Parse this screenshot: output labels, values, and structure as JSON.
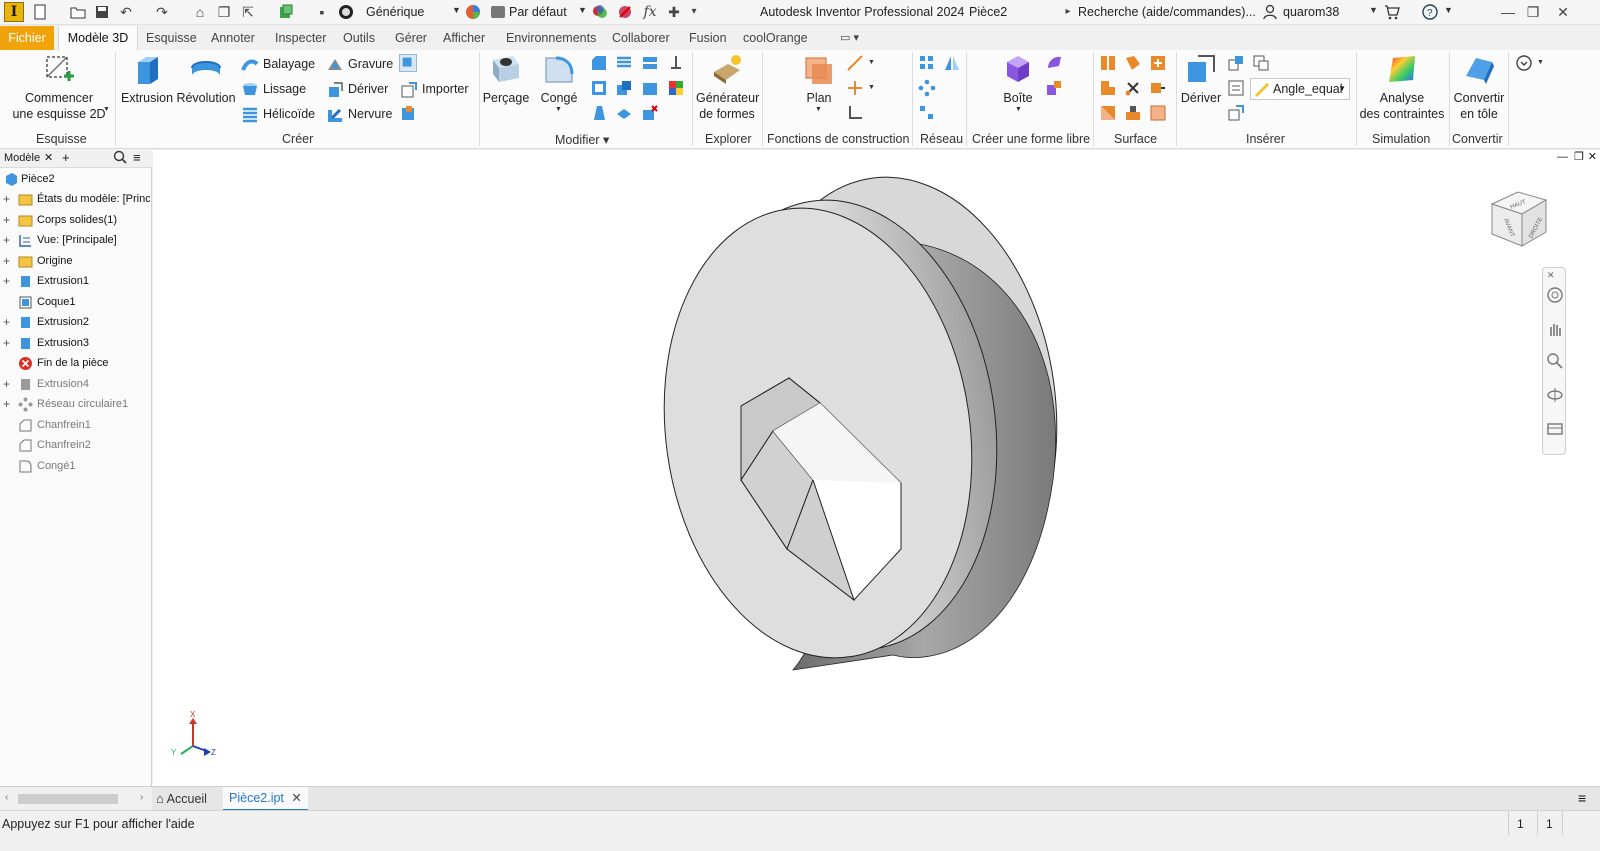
{
  "titlebar": {
    "style_value": "Générique",
    "appearance_value": "Par défaut",
    "app_title": "Autodesk Inventor Professional 2024",
    "doc_name": "Pièce2",
    "search_placeholder": "Recherche (aide/commandes)...",
    "username": "quarom38"
  },
  "tabs": {
    "file": "Fichier",
    "items": [
      "Modèle 3D",
      "Esquisse",
      "Annoter",
      "Inspecter",
      "Outils",
      "Gérer",
      "Afficher",
      "Environnements",
      "Collaborer",
      "Fusion",
      "coolOrange"
    ]
  },
  "ribbon": {
    "sketch": {
      "title": "Esquisse",
      "start_line1": "Commencer",
      "start_line2": "une esquisse 2D"
    },
    "create": {
      "title": "Créer",
      "extrusion": "Extrusion",
      "revolution": "Révolution",
      "balayage": "Balayage",
      "lissage": "Lissage",
      "helicoide": "Hélicoïde",
      "gravure": "Gravure",
      "deriver": "Dériver",
      "nervure": "Nervure",
      "importer": "Importer"
    },
    "modify": {
      "title": "Modifier",
      "percage": "Perçage",
      "conge": "Congé"
    },
    "explore": {
      "title": "Explorer",
      "gen_line1": "Générateur",
      "gen_line2": "de formes"
    },
    "work": {
      "title": "Fonctions de construction",
      "plan": "Plan"
    },
    "pattern": {
      "title": "Réseau"
    },
    "freeform": {
      "title": "Créer une forme libre",
      "boite": "Boîte"
    },
    "surface": {
      "title": "Surface"
    },
    "insert": {
      "title": "Insérer",
      "deriver": "Dériver",
      "angle_equal": "Angle_equal"
    },
    "simulation": {
      "title": "Simulation",
      "line1": "Analyse",
      "line2": "des contraintes"
    },
    "convert": {
      "title": "Convertir",
      "line1": "Convertir",
      "line2": "en tôle"
    }
  },
  "browser": {
    "tab_label": "Modèle",
    "root": "Pièce2",
    "items": [
      {
        "label": "États du modèle: [Principale]",
        "dim": false,
        "expand": true
      },
      {
        "label": "Corps solides(1)",
        "dim": false,
        "expand": true
      },
      {
        "label": "Vue: [Principale]",
        "dim": false,
        "expand": true
      },
      {
        "label": "Origine",
        "dim": false,
        "expand": true
      },
      {
        "label": "Extrusion1",
        "dim": false,
        "expand": true
      },
      {
        "label": "Coque1",
        "dim": false,
        "expand": false
      },
      {
        "label": "Extrusion2",
        "dim": false,
        "expand": true
      },
      {
        "label": "Extrusion3",
        "dim": false,
        "expand": true
      },
      {
        "label": "Fin de la pièce",
        "dim": false,
        "expand": false
      },
      {
        "label": "Extrusion4",
        "dim": true,
        "expand": true
      },
      {
        "label": "Réseau circulaire1",
        "dim": true,
        "expand": true
      },
      {
        "label": "Chanfrein1",
        "dim": true,
        "expand": false
      },
      {
        "label": "Chanfrein2",
        "dim": true,
        "expand": false
      },
      {
        "label": "Congé1",
        "dim": true,
        "expand": false
      }
    ]
  },
  "viewcube": {
    "face_front": "AVANT",
    "face_right": "DROITE",
    "face_top": "HAUT"
  },
  "triad": {
    "x": "X",
    "y": "Y",
    "z": "Z"
  },
  "doctabs": {
    "home": "Accueil",
    "active": "Pièce2.ipt"
  },
  "status": {
    "help": "Appuyez sur F1 pour afficher l'aide",
    "count1": "1",
    "count2": "1"
  }
}
